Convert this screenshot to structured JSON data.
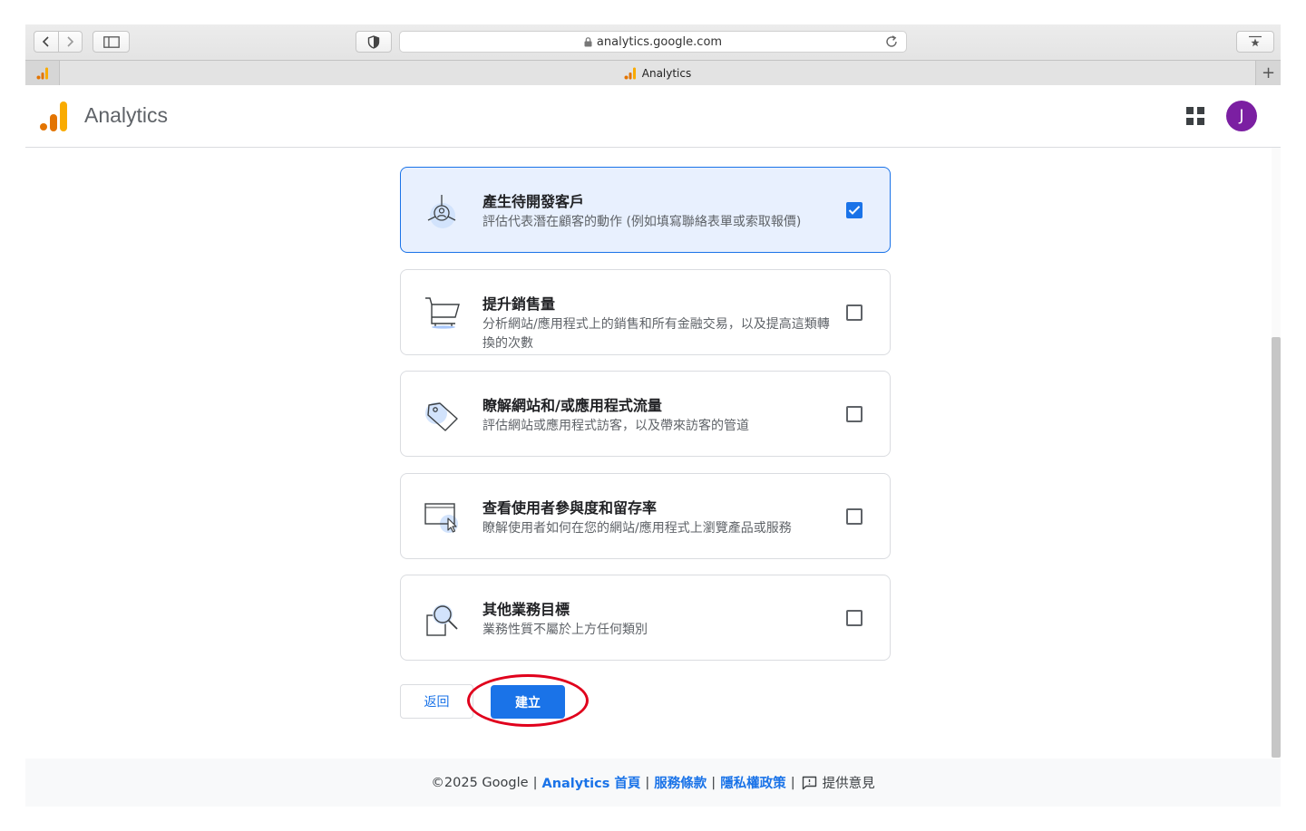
{
  "browser": {
    "url": "analytics.google.com",
    "tab_title": "Analytics",
    "new_tab_symbol": "+"
  },
  "header": {
    "app_title": "Analytics",
    "avatar_initial": "J"
  },
  "objectives": [
    {
      "title": "產生待開發客戶",
      "desc": "評估代表潛在顧客的動作 (例如填寫聯絡表單或索取報價)",
      "checked": true,
      "icon": "target-person-icon"
    },
    {
      "title": "提升銷售量",
      "desc": "分析網站/應用程式上的銷售和所有金融交易，以及提高這類轉換的次數",
      "checked": false,
      "icon": "shopping-cart-icon"
    },
    {
      "title": "瞭解網站和/或應用程式流量",
      "desc": "評估網站或應用程式訪客，以及帶來訪客的管道",
      "checked": false,
      "icon": "price-tag-icon"
    },
    {
      "title": "查看使用者參與度和留存率",
      "desc": "瞭解使用者如何在您的網站/應用程式上瀏覽產品或服務",
      "checked": false,
      "icon": "browser-cursor-icon"
    },
    {
      "title": "其他業務目標",
      "desc": "業務性質不屬於上方任何類別",
      "checked": false,
      "icon": "document-magnifier-icon"
    }
  ],
  "actions": {
    "back_label": "返回",
    "create_label": "建立"
  },
  "footer": {
    "copyright": "©2025 Google",
    "home_link": "Analytics 首頁",
    "terms_link": "服務條款",
    "privacy_link": "隱私權政策",
    "feedback_label": "提供意見",
    "separator": "|"
  },
  "colors": {
    "accent": "#1a73e8",
    "selected_card_bg": "#e8f0fe",
    "avatar_bg": "#7b1fa2",
    "annotation_ring": "#e0001c",
    "logo_orange": "#f9ab00",
    "logo_dark_orange": "#e37400"
  }
}
